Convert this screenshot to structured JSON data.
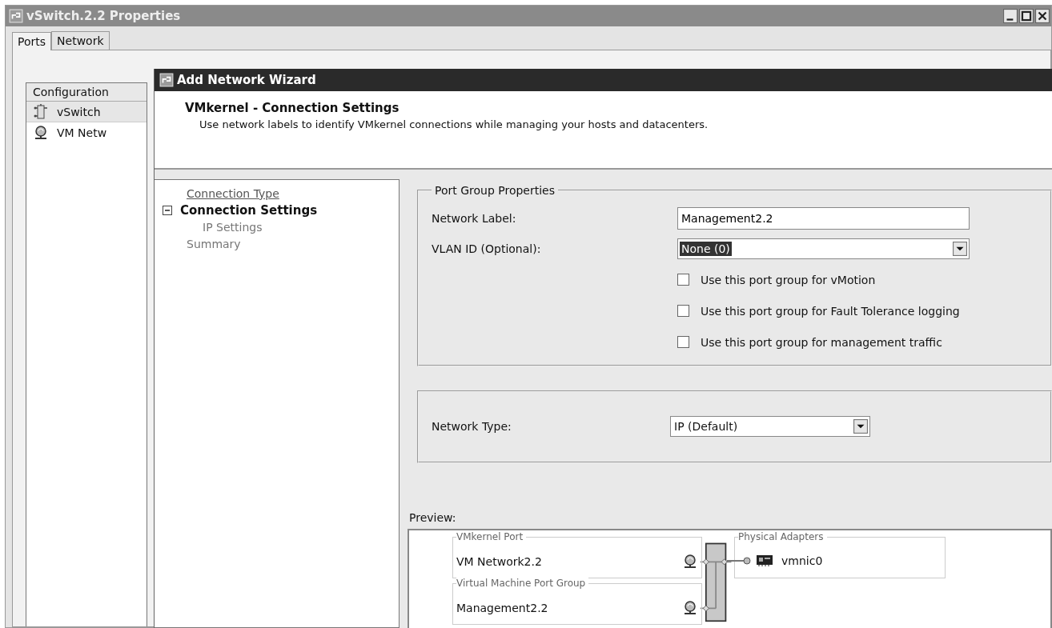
{
  "window": {
    "title": "vSwitch.2.2 Properties"
  },
  "tabs": [
    {
      "label": "Ports",
      "selected": true
    },
    {
      "label": "Network",
      "selected": false
    }
  ],
  "ports_list": {
    "header": "Configuration",
    "rows": [
      {
        "label": "vSwitch",
        "kind": "switch",
        "selected": true
      },
      {
        "label": "VM Netw",
        "kind": "network",
        "selected": false
      }
    ]
  },
  "wizard": {
    "title": "Add Network Wizard",
    "heading": "VMkernel - Connection Settings",
    "subheading": "Use network labels to identify VMkernel connections while managing your hosts and datacenters.",
    "steps": [
      {
        "label": "Connection Type",
        "kind": "done"
      },
      {
        "label": "Connection Settings",
        "kind": "current",
        "expanded": true,
        "children": [
          {
            "label": "IP Settings",
            "kind": "pending"
          }
        ]
      },
      {
        "label": "Summary",
        "kind": "pending"
      }
    ],
    "port_group": {
      "legend": "Port Group Properties",
      "network_label": {
        "label": "Network Label:",
        "value": "Management2.2"
      },
      "vlan_id": {
        "label": "VLAN ID (Optional):",
        "value": "None (0)"
      },
      "options": [
        {
          "label": "Use this port group for vMotion",
          "checked": false
        },
        {
          "label": "Use this port group for Fault Tolerance logging",
          "checked": false
        },
        {
          "label": "Use this port group for management traffic",
          "checked": false
        }
      ]
    },
    "network_type": {
      "label": "Network Type:",
      "value": "IP (Default)"
    },
    "preview": {
      "label": "Preview:",
      "port_groups": [
        {
          "legend": "VMkernel Port",
          "name": "VM Network2.2"
        },
        {
          "legend": "Virtual Machine Port Group",
          "name": "Management2.2"
        }
      ],
      "adapters": {
        "legend": "Physical Adapters",
        "items": [
          "vmnic0"
        ]
      }
    }
  }
}
